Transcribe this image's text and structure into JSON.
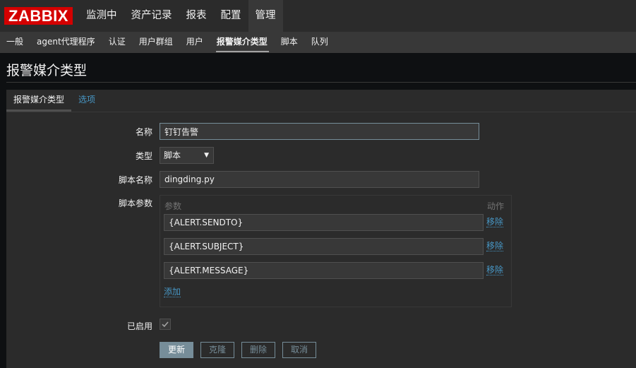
{
  "app": {
    "logo": "ZABBIX",
    "accent_color": "#d40000"
  },
  "top_nav": {
    "items": [
      {
        "label": "监测中"
      },
      {
        "label": "资产记录"
      },
      {
        "label": "报表"
      },
      {
        "label": "配置"
      },
      {
        "label": "管理",
        "active": true
      }
    ]
  },
  "sub_nav": {
    "items": [
      {
        "label": "一般"
      },
      {
        "label": "agent代理程序"
      },
      {
        "label": "认证"
      },
      {
        "label": "用户群组"
      },
      {
        "label": "用户"
      },
      {
        "label": "报警媒介类型",
        "active": true
      },
      {
        "label": "脚本"
      },
      {
        "label": "队列"
      }
    ]
  },
  "page": {
    "title": "报警媒介类型"
  },
  "tabs": [
    {
      "label": "报警媒介类型",
      "active": true
    },
    {
      "label": "选项"
    }
  ],
  "form": {
    "name_label": "名称",
    "name_value": "钉钉告警",
    "type_label": "类型",
    "type_value": "脚本",
    "script_name_label": "脚本名称",
    "script_name_value": "dingding.py",
    "script_params_label": "脚本参数",
    "params_header": "参数",
    "action_header": "动作",
    "params": [
      {
        "value": "{ALERT.SENDTO}",
        "remove_label": "移除"
      },
      {
        "value": "{ALERT.SUBJECT}",
        "remove_label": "移除"
      },
      {
        "value": "{ALERT.MESSAGE}",
        "remove_label": "移除"
      }
    ],
    "add_label": "添加",
    "enabled_label": "已启用",
    "enabled": true
  },
  "buttons": {
    "update": "更新",
    "clone": "克隆",
    "delete": "删除",
    "cancel": "取消"
  }
}
